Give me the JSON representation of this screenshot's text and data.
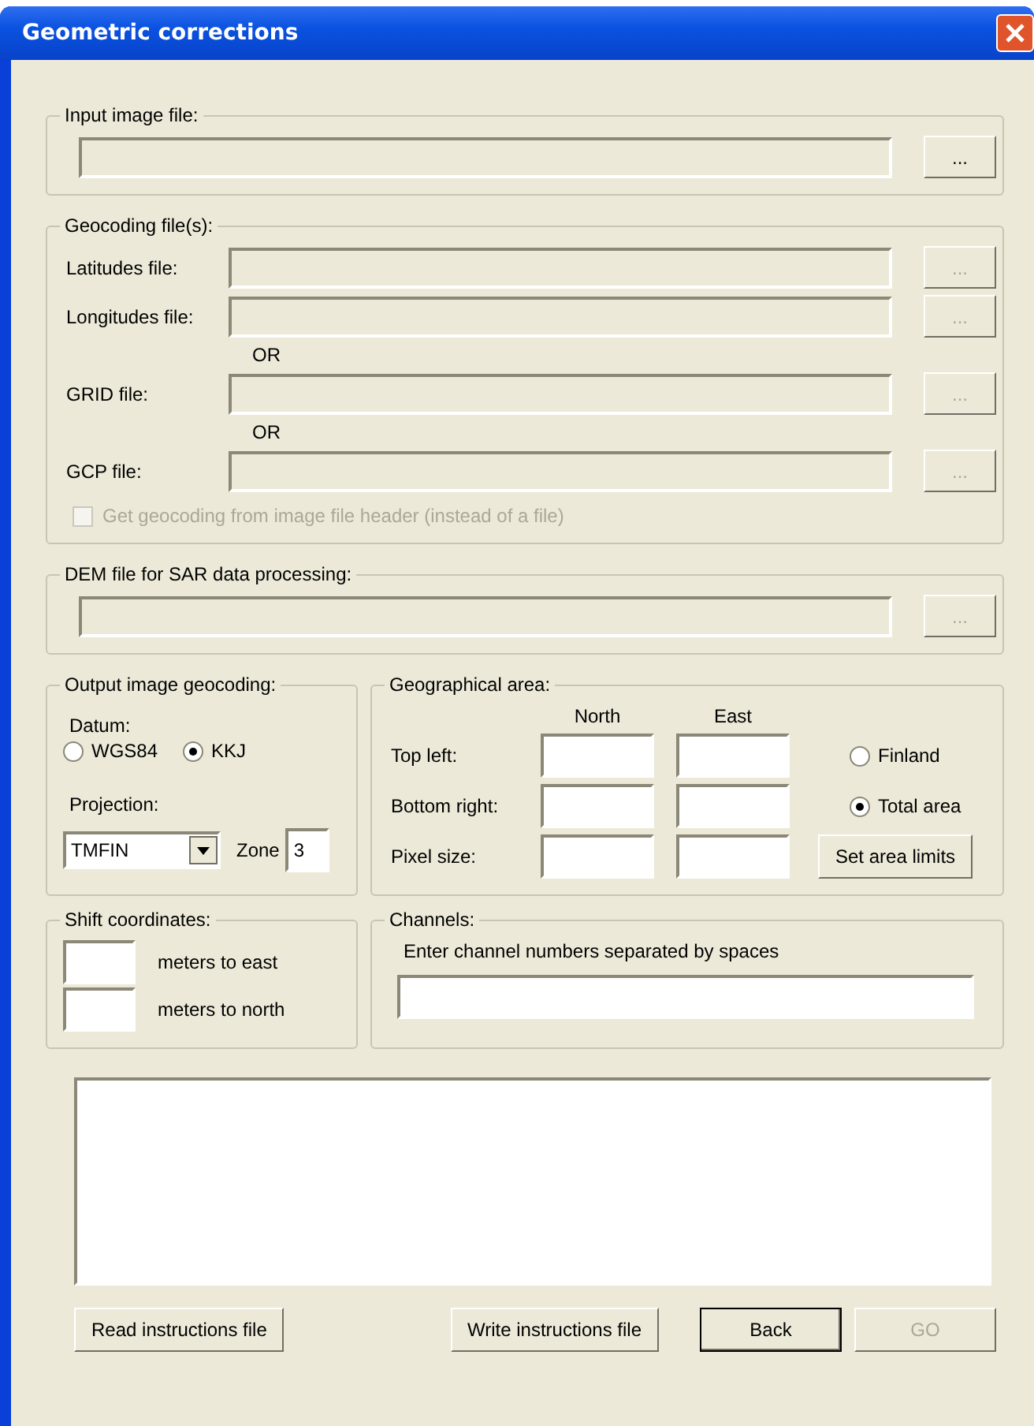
{
  "window": {
    "title": "Geometric corrections"
  },
  "input_image": {
    "label": "Input image file:",
    "browse": "...",
    "disabled": false
  },
  "geocoding": {
    "label": "Geocoding file(s):",
    "rows": [
      {
        "kind": "file",
        "label": "Latitudes file:",
        "browse": "...",
        "disabled": true
      },
      {
        "kind": "file",
        "label": "Longitudes file:",
        "browse": "...",
        "disabled": true
      },
      {
        "kind": "separator",
        "label": "OR"
      },
      {
        "kind": "file",
        "label": "GRID file:",
        "browse": "...",
        "disabled": true
      },
      {
        "kind": "separator",
        "label": "OR"
      },
      {
        "kind": "file",
        "label": "GCP file:",
        "browse": "...",
        "disabled": true
      }
    ],
    "header_checkbox": {
      "label": "Get geocoding from image file header (instead of a file)",
      "checked": false,
      "disabled": true
    }
  },
  "dem": {
    "label": "DEM file for SAR data processing:",
    "browse": "...",
    "disabled": true
  },
  "output_geocoding": {
    "label": "Output image geocoding:",
    "datum_label": "Datum:",
    "datum_options": [
      {
        "label": "WGS84",
        "selected": false
      },
      {
        "label": "KKJ",
        "selected": true
      }
    ],
    "projection_label": "Projection:",
    "projection": "TMFIN",
    "zone_label": "Zone",
    "zone": "3"
  },
  "geographical_area": {
    "label": "Geographical area:",
    "columns": [
      "North",
      "East"
    ],
    "rows": [
      "Top left:",
      "Bottom right:",
      "Pixel size:"
    ],
    "area_options": [
      {
        "label": "Finland",
        "selected": false
      },
      {
        "label": "Total area",
        "selected": true
      }
    ],
    "set_limits": "Set area limits"
  },
  "shift": {
    "label": "Shift coordinates:",
    "rows": [
      "meters to east",
      "meters to north"
    ]
  },
  "channels": {
    "label": "Channels:",
    "hint": "Enter channel numbers separated by spaces"
  },
  "buttons": [
    {
      "label": "Read instructions file",
      "disabled": false,
      "default": false
    },
    {
      "label": "Write instructions file",
      "disabled": false,
      "default": false
    },
    {
      "label": "Back",
      "disabled": false,
      "default": true
    },
    {
      "label": "GO",
      "disabled": true,
      "default": false
    }
  ]
}
